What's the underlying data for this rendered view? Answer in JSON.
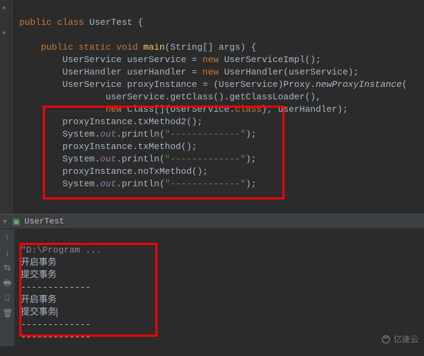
{
  "code": {
    "l1a": "public class ",
    "l1b": "UserTest {",
    "l3a": "public static void ",
    "l3b": "main",
    "l3c": "(String[] args) {",
    "l4a": "UserService userService = ",
    "l4b": "new ",
    "l4c": "UserServiceImpl();",
    "l5a": "UserHandler userHandler = ",
    "l5b": "new ",
    "l5c": "UserHandler(userService);",
    "l6a": "UserService proxyInstance = (UserService)Proxy.",
    "l6b": "newProxyInstance",
    "l6c": "(",
    "l7": "userService.getClass().getClassLoader(),",
    "l8a": "new ",
    "l8b": "Class[]{UserService.",
    "l8c": "class",
    "l8d": "}, userHandler);",
    "l9": "proxyInstance.txMethod2();",
    "l10a": "System.",
    "l10b": "out",
    "l10c": ".println(",
    "l10d": "\"-------------\"",
    "l10e": ");",
    "l11": "proxyInstance.txMethod();",
    "l12a": "System.",
    "l12b": "out",
    "l12c": ".println(",
    "l12d": "\"-------------\"",
    "l12e": ");",
    "l13": "proxyInstance.noTxMethod();",
    "l14a": "System.",
    "l14b": "out",
    "l14c": ".println(",
    "l14d": "\"-------------\"",
    "l14e": ");"
  },
  "run": {
    "tab": "UserTest"
  },
  "console": {
    "header": "\"D:\\Program ...",
    "lines": [
      "开启事务",
      "提交事务",
      "-------------",
      "开启事务",
      "提交事务",
      "-------------",
      "-------------"
    ]
  },
  "watermark": "亿速云"
}
